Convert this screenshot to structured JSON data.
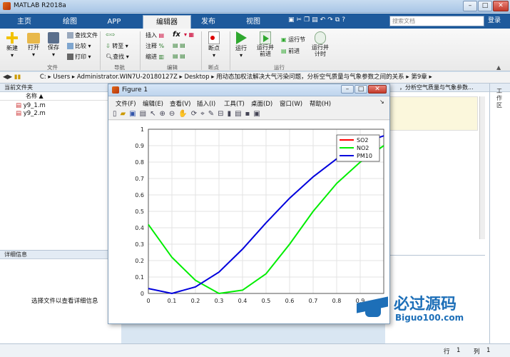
{
  "app": {
    "title": "MATLAB R2018a"
  },
  "tabs": [
    "主页",
    "绘图",
    "APP",
    "编辑器",
    "发布",
    "视图"
  ],
  "search": {
    "placeholder": "搜索文档"
  },
  "sign_in": "登录",
  "ribbon": {
    "file": {
      "new": "新建",
      "open": "打开",
      "save": "保存",
      "find_files": "查找文件",
      "compare": "比较",
      "print": "打印",
      "group": "文件"
    },
    "nav": {
      "goto": "转至",
      "find": "查找",
      "group": "导航"
    },
    "edit": {
      "insert": "插入",
      "comment": "注释",
      "indent": "缩进",
      "fx": "fx",
      "group": "编辑"
    },
    "breakpoints": {
      "label": "断点",
      "group": "断点"
    },
    "run": {
      "run": "运行",
      "run_advance": "运行并\n前进",
      "run_section": "运行节",
      "advance": "前进",
      "run_time": "运行并\n计时",
      "group": "运行"
    }
  },
  "address": {
    "parts": [
      "C:",
      "Users",
      "Administrator.WIN7U-20180127Z",
      "Desktop",
      "用动态加权法解决大气污染问题，分析空气质量与气象参数之间的关系",
      "第9章"
    ]
  },
  "current_folder": {
    "title": "当前文件夹",
    "column": "名称",
    "files": [
      "y9_1.m",
      "y9_2.m"
    ]
  },
  "details": {
    "title": "详细信息",
    "hint": "选择文件以查看详细信息"
  },
  "workspace": {
    "title": "工作区",
    "tail_text": "，分析空气质量与气象参数..."
  },
  "figure": {
    "title": "Figure 1",
    "menu": [
      "文件(F)",
      "编辑(E)",
      "查看(V)",
      "插入(I)",
      "工具(T)",
      "桌面(D)",
      "窗口(W)",
      "帮助(H)"
    ]
  },
  "chart_data": {
    "type": "line",
    "title": "",
    "xlabel": "",
    "ylabel": "",
    "xlim": [
      0,
      1
    ],
    "ylim": [
      0,
      1
    ],
    "xticks": [
      "0",
      "0.1",
      "0.2",
      "0.3",
      "0.4",
      "0.5",
      "0.6",
      "0.7",
      "0.8",
      "0.9"
    ],
    "yticks": [
      "0",
      "0.1",
      "0.2",
      "0.3",
      "0.4",
      "0.5",
      "0.6",
      "0.7",
      "0.8",
      "0.9",
      "1"
    ],
    "grid": true,
    "legend": "top-right",
    "series": [
      {
        "name": "SO2",
        "color": "#ff0000",
        "x": [],
        "y": []
      },
      {
        "name": "NO2",
        "color": "#00ee00",
        "x": [
          0,
          0.1,
          0.2,
          0.3,
          0.4,
          0.5,
          0.6,
          0.7,
          0.8,
          0.9,
          1.0
        ],
        "y": [
          0.42,
          0.22,
          0.08,
          0.0,
          0.02,
          0.12,
          0.3,
          0.5,
          0.67,
          0.8,
          0.9
        ]
      },
      {
        "name": "PM10",
        "color": "#0000dd",
        "x": [
          0,
          0.1,
          0.2,
          0.3,
          0.4,
          0.5,
          0.6,
          0.7,
          0.8,
          0.9,
          1.0
        ],
        "y": [
          0.03,
          0.0,
          0.04,
          0.13,
          0.27,
          0.43,
          0.58,
          0.71,
          0.82,
          0.91,
          0.96
        ]
      }
    ]
  },
  "watermark": {
    "text": "必过源码",
    "url": "Biguo100.com"
  },
  "status": {
    "row_label": "行",
    "row": "1",
    "col_label": "列",
    "col": "1"
  },
  "colors": {
    "tab_bar": "#1e5a9c",
    "accent": "#d35400"
  }
}
